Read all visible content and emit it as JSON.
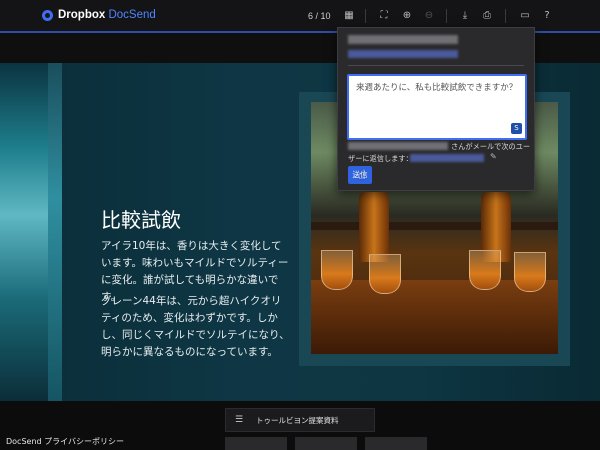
{
  "header": {
    "logo_brand": "Dropbox",
    "logo_product": "DocSend",
    "pager": "6 / 10",
    "icons": [
      "grid-icon",
      "fullscreen-icon",
      "add-icon",
      "disabled-action-icon",
      "download-icon",
      "print-icon",
      "comment-icon",
      "help-icon"
    ],
    "accent_color": "#2d4fa8"
  },
  "slide": {
    "title": "比較試飲",
    "paragraph_1": "アイラ10年は、香りは大きく変化しています。味わいもマイルドでソルティーに変化。誰が試しても明らかな違いです。",
    "paragraph_2": "グレーン44年は、元から超ハイクオリティのため、変化はわずかです。しかし、同じくマイルドでソルテイになり、明らかに異なるものになっています。"
  },
  "reply_popup": {
    "message": "来週あたりに、私も比較試飲できますか？",
    "reply_note_line_1": "さんがメールで次のユー",
    "reply_note_line_2": "ザーに返信します：",
    "send_label": "送信",
    "send_color": "#2f63e0"
  },
  "bottom": {
    "toc_label": "トゥールビヨン提案資料",
    "privacy": "DocSend プライバシーポリシー"
  }
}
